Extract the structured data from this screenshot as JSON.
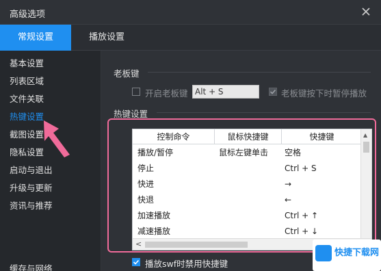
{
  "window": {
    "title": "高级选项"
  },
  "tabs": [
    {
      "label": "常规设置",
      "active": true
    },
    {
      "label": "播放设置",
      "active": false
    }
  ],
  "sidebar": {
    "items": [
      {
        "label": "基本设置",
        "active": false
      },
      {
        "label": "列表区域",
        "active": false
      },
      {
        "label": "文件关联",
        "active": false
      },
      {
        "label": "热键设置",
        "active": true
      },
      {
        "label": "截图设置",
        "active": false
      },
      {
        "label": "隐私设置",
        "active": false
      },
      {
        "label": "启动与退出",
        "active": false
      },
      {
        "label": "升级与更新",
        "active": false
      },
      {
        "label": "资讯与推荐",
        "active": false
      },
      {
        "label": "缓存与网络",
        "active": false
      }
    ]
  },
  "boss_key": {
    "section_title": "老板键",
    "enable_label": "开启老板键",
    "enable_checked": false,
    "hotkey_value": "Alt + S",
    "pause_label": "老板键按下时暂停播放",
    "pause_checked": true
  },
  "hotkeys": {
    "section_title": "热键设置",
    "columns": [
      "控制命令",
      "鼠标快捷键",
      "快捷键"
    ],
    "rows": [
      {
        "command": "播放/暂停",
        "mouse": "鼠标左键单击",
        "key": "空格"
      },
      {
        "command": "停止",
        "mouse": "",
        "key": "Ctrl + S"
      },
      {
        "command": "快进",
        "mouse": "",
        "key": "→"
      },
      {
        "command": "快退",
        "mouse": "",
        "key": "←"
      },
      {
        "command": "加速播放",
        "mouse": "",
        "key": "Ctrl + ↑"
      },
      {
        "command": "减速播放",
        "mouse": "",
        "key": "Ctrl + ↓"
      }
    ]
  },
  "bottom_option": {
    "label": "播放swf时禁用快捷键",
    "checked": true
  },
  "watermark": {
    "text": "快捷下载网"
  },
  "colors": {
    "accent": "#1f8ff0",
    "highlight_outline": "#f06b9a",
    "arrow": "#f06b9a"
  }
}
